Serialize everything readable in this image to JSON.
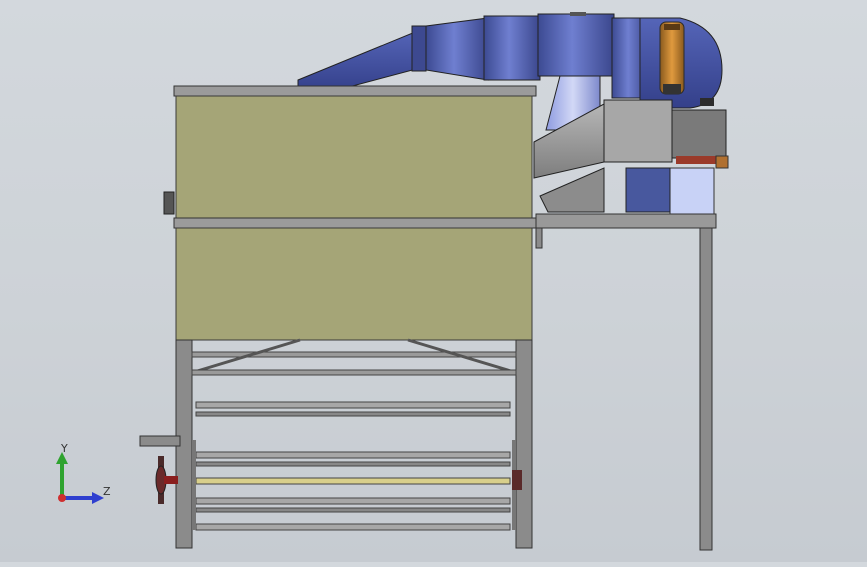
{
  "scene": {
    "colors": {
      "background": "#cfd4d9",
      "panel_fill": "#a5a577",
      "frame_steel": "#8a8a8a",
      "frame_dark": "#3e3e3e",
      "blower_blue": "#4a5aa6",
      "blower_dark": "#2f3a7a",
      "duct_gray": "#9a9a9a",
      "motor_orange": "#c9832f",
      "light_blue_box": "#c9d3f7",
      "roller_yellow": "#d8cf8b"
    }
  },
  "triad": {
    "y_label": "Y",
    "z_label": "Z",
    "y_color": "#2fa32f",
    "z_color": "#2f3fcf",
    "x_color": "#cf2f2f"
  }
}
